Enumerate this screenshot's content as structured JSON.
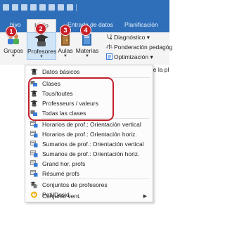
{
  "ribbon_tabs": [
    "hivo",
    "Inicio",
    "Entrada de datos",
    "Planificación"
  ],
  "ribbon_buttons": [
    {
      "label": "Grupos",
      "icon": "groups-icon"
    },
    {
      "label": "Profesores",
      "icon": "teachers-icon"
    },
    {
      "label": "Aulas",
      "icon": "rooms-icon"
    },
    {
      "label": "Materias",
      "icon": "subjects-icon"
    }
  ],
  "ribbon_small_commands": [
    {
      "label": "Diagnóstico",
      "icon": "diagnostic-icon",
      "has_dropdown": true
    },
    {
      "label": "Ponderación pedagóg",
      "icon": "weighting-icon",
      "has_dropdown": false
    },
    {
      "label": "Optimización",
      "icon": "optimization-icon",
      "has_dropdown": true
    }
  ],
  "right_clipped_text": "de la pl",
  "badges": [
    "1",
    "2",
    "3",
    "4"
  ],
  "menu_items": [
    {
      "label": "Datos básicos",
      "icon": "teacher-data-icon",
      "highlighted": false
    },
    {
      "label": "Clases",
      "icon": "classes-icon",
      "highlighted": true
    },
    {
      "label": "Tous/toutes",
      "icon": "teacher-icon",
      "highlighted": true
    },
    {
      "label": "Professeurs / valeurs",
      "icon": "teacher-icon",
      "highlighted": true
    },
    {
      "label": "Todas las clases",
      "icon": "classes-icon",
      "highlighted": true
    },
    {
      "label": "Horarios de prof.: Orientación vertical",
      "icon": "timetable-icon",
      "highlighted": false
    },
    {
      "label": "Horarios de prof.: Orientación horiz.",
      "icon": "timetable-icon",
      "highlighted": false
    },
    {
      "label": "Sumarios de prof.: Orientación vertical",
      "icon": "timetable-icon",
      "highlighted": false
    },
    {
      "label": "Sumarios de prof.: Orientación horiz.",
      "icon": "timetable-icon",
      "highlighted": false
    },
    {
      "label": "Grand hor. profs",
      "icon": "timetable-icon",
      "highlighted": false
    },
    {
      "label": "Résumé profs",
      "icon": "timetable-icon",
      "highlighted": false
    },
    {
      "label": "Conjuntos de profesores",
      "icon": "teacher-sets-icon",
      "highlighted": false
    },
    {
      "label": "Peti/Desid.",
      "icon": "wishes-icon",
      "highlighted": false
    },
    {
      "label": "Conjunto vent.",
      "icon": "",
      "highlighted": false,
      "submenu": true
    }
  ],
  "colors": {
    "ribbon_blue": "#2f6fba",
    "badge_red": "#c8202a",
    "highlight_red": "#c0202a"
  }
}
